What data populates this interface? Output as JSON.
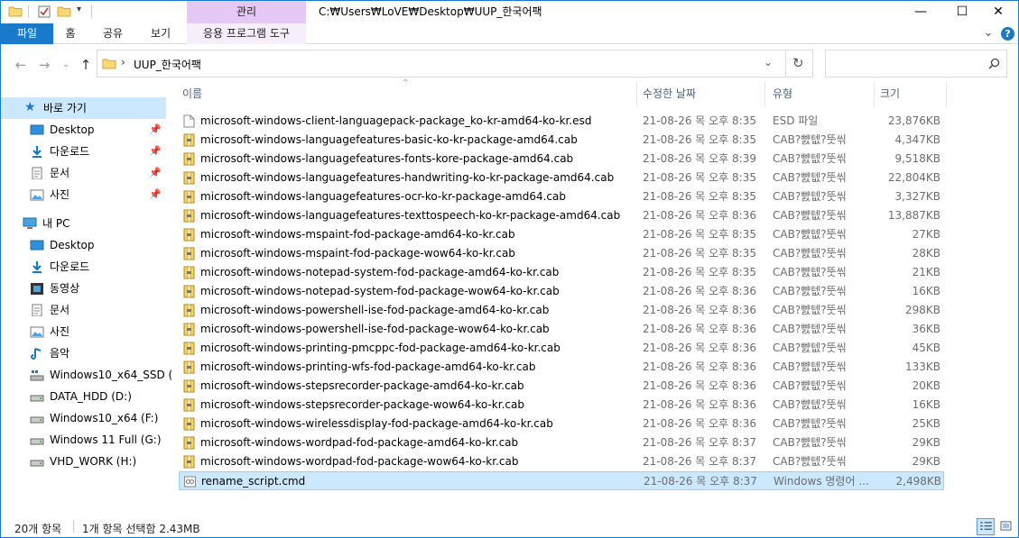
{
  "window": {
    "title": "C:₩Users₩LoVE₩Desktop₩UUP_한국어팩",
    "context_header": "관리",
    "controls": {
      "minimize": "—",
      "maximize": "☐",
      "close": "✕"
    }
  },
  "ribbon": {
    "tabs": [
      "파일",
      "홈",
      "공유",
      "보기",
      "응용 프로그램 도구"
    ],
    "expand_glyph": "⌄",
    "help_glyph": "?"
  },
  "address": {
    "path": "UUP_한국어팩",
    "separator": "›",
    "search_placeholder": ""
  },
  "sidebar": {
    "quick_access": {
      "label": "바로 가기"
    },
    "items": [
      {
        "label": "Desktop",
        "icon": "desktop-folder-icon",
        "pinned": true
      },
      {
        "label": "다운로드",
        "icon": "download-folder-icon",
        "pinned": true
      },
      {
        "label": "문서",
        "icon": "documents-folder-icon",
        "pinned": true
      },
      {
        "label": "사진",
        "icon": "pictures-folder-icon",
        "pinned": true
      }
    ],
    "this_pc": {
      "label": "내 PC"
    },
    "pc_items": [
      {
        "label": "Desktop",
        "icon": "desktop-folder-icon"
      },
      {
        "label": "다운로드",
        "icon": "download-folder-icon"
      },
      {
        "label": "동영상",
        "icon": "videos-folder-icon"
      },
      {
        "label": "문서",
        "icon": "documents-folder-icon"
      },
      {
        "label": "사진",
        "icon": "pictures-folder-icon"
      },
      {
        "label": "음악",
        "icon": "music-folder-icon"
      },
      {
        "label": "Windows10_x64_SSD (",
        "icon": "system-drive-icon"
      },
      {
        "label": "DATA_HDD (D:)",
        "icon": "drive-icon"
      },
      {
        "label": "Windows10_x64 (F:)",
        "icon": "drive-icon"
      },
      {
        "label": "Windows 11 Full (G:)",
        "icon": "drive-icon"
      },
      {
        "label": "VHD_WORK (H:)",
        "icon": "drive-icon"
      }
    ]
  },
  "columns": {
    "name": "이름",
    "date": "수정한 날짜",
    "type": "유형",
    "size": "크기"
  },
  "files": [
    {
      "name": "microsoft-windows-client-languagepack-package_ko-kr-amd64-ko-kr.esd",
      "date": "21-08-26 목 오후 8:35",
      "type": "ESD 파일",
      "size": "23,876KB",
      "icon": "esd-file-icon"
    },
    {
      "name": "microsoft-windows-languagefeatures-basic-ko-kr-package-amd64.cab",
      "date": "21-08-26 목 오후 8:35",
      "type": "CAB?뺤텞?뚯씪",
      "size": "4,347KB",
      "icon": "cab-file-icon"
    },
    {
      "name": "microsoft-windows-languagefeatures-fonts-kore-package-amd64.cab",
      "date": "21-08-26 목 오후 8:39",
      "type": "CAB?뺤텞?뚯씪",
      "size": "9,518KB",
      "icon": "cab-file-icon"
    },
    {
      "name": "microsoft-windows-languagefeatures-handwriting-ko-kr-package-amd64.cab",
      "date": "21-08-26 목 오후 8:35",
      "type": "CAB?뺤텞?뚯씪",
      "size": "22,804KB",
      "icon": "cab-file-icon"
    },
    {
      "name": "microsoft-windows-languagefeatures-ocr-ko-kr-package-amd64.cab",
      "date": "21-08-26 목 오후 8:35",
      "type": "CAB?뺤텞?뚯씪",
      "size": "3,327KB",
      "icon": "cab-file-icon"
    },
    {
      "name": "microsoft-windows-languagefeatures-texttospeech-ko-kr-package-amd64.cab",
      "date": "21-08-26 목 오후 8:36",
      "type": "CAB?뺤텞?뚯씪",
      "size": "13,887KB",
      "icon": "cab-file-icon"
    },
    {
      "name": "microsoft-windows-mspaint-fod-package-amd64-ko-kr.cab",
      "date": "21-08-26 목 오후 8:35",
      "type": "CAB?뺤텞?뚯씪",
      "size": "27KB",
      "icon": "cab-file-icon"
    },
    {
      "name": "microsoft-windows-mspaint-fod-package-wow64-ko-kr.cab",
      "date": "21-08-26 목 오후 8:35",
      "type": "CAB?뺤텞?뚯씪",
      "size": "28KB",
      "icon": "cab-file-icon"
    },
    {
      "name": "microsoft-windows-notepad-system-fod-package-amd64-ko-kr.cab",
      "date": "21-08-26 목 오후 8:35",
      "type": "CAB?뺤텞?뚯씪",
      "size": "21KB",
      "icon": "cab-file-icon"
    },
    {
      "name": "microsoft-windows-notepad-system-fod-package-wow64-ko-kr.cab",
      "date": "21-08-26 목 오후 8:36",
      "type": "CAB?뺤텞?뚯씪",
      "size": "16KB",
      "icon": "cab-file-icon"
    },
    {
      "name": "microsoft-windows-powershell-ise-fod-package-amd64-ko-kr.cab",
      "date": "21-08-26 목 오후 8:36",
      "type": "CAB?뺤텞?뚯씪",
      "size": "298KB",
      "icon": "cab-file-icon"
    },
    {
      "name": "microsoft-windows-powershell-ise-fod-package-wow64-ko-kr.cab",
      "date": "21-08-26 목 오후 8:36",
      "type": "CAB?뺤텞?뚯씪",
      "size": "36KB",
      "icon": "cab-file-icon"
    },
    {
      "name": "microsoft-windows-printing-pmcppc-fod-package-amd64-ko-kr.cab",
      "date": "21-08-26 목 오후 8:36",
      "type": "CAB?뺤텞?뚯씪",
      "size": "45KB",
      "icon": "cab-file-icon"
    },
    {
      "name": "microsoft-windows-printing-wfs-fod-package-amd64-ko-kr.cab",
      "date": "21-08-26 목 오후 8:36",
      "type": "CAB?뺤텞?뚯씪",
      "size": "133KB",
      "icon": "cab-file-icon"
    },
    {
      "name": "microsoft-windows-stepsrecorder-package-amd64-ko-kr.cab",
      "date": "21-08-26 목 오후 8:36",
      "type": "CAB?뺤텞?뚯씪",
      "size": "20KB",
      "icon": "cab-file-icon"
    },
    {
      "name": "microsoft-windows-stepsrecorder-package-wow64-ko-kr.cab",
      "date": "21-08-26 목 오후 8:36",
      "type": "CAB?뺤텞?뚯씪",
      "size": "16KB",
      "icon": "cab-file-icon"
    },
    {
      "name": "microsoft-windows-wirelessdisplay-fod-package-amd64-ko-kr.cab",
      "date": "21-08-26 목 오후 8:36",
      "type": "CAB?뺤텞?뚯씪",
      "size": "25KB",
      "icon": "cab-file-icon"
    },
    {
      "name": "microsoft-windows-wordpad-fod-package-amd64-ko-kr.cab",
      "date": "21-08-26 목 오후 8:37",
      "type": "CAB?뺤텞?뚯씪",
      "size": "29KB",
      "icon": "cab-file-icon"
    },
    {
      "name": "microsoft-windows-wordpad-fod-package-wow64-ko-kr.cab",
      "date": "21-08-26 목 오후 8:37",
      "type": "CAB?뺤텞?뚯씪",
      "size": "29KB",
      "icon": "cab-file-icon"
    },
    {
      "name": "rename_script.cmd",
      "date": "21-08-26 목 오후 8:37",
      "type": "Windows 명령어 ...",
      "size": "2,498KB",
      "icon": "cmd-file-icon",
      "selected": true
    }
  ],
  "status": {
    "count": "20개 항목",
    "selection": "1개 항목 선택함 2.43MB"
  },
  "colors": {
    "accent": "#1979ca",
    "selection": "#cce8ff",
    "context_tab": "#e6c8f6",
    "folder": "#f8d775",
    "muted_text": "#6d6d6d"
  }
}
